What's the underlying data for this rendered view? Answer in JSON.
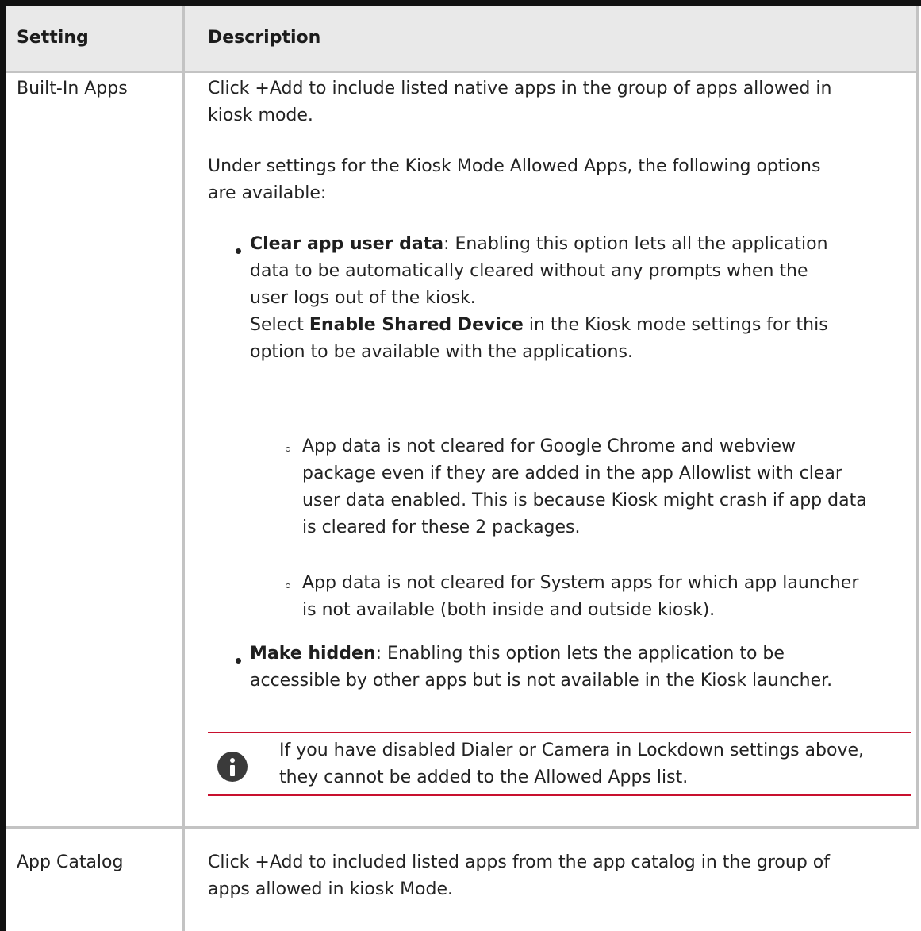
{
  "table": {
    "headers": {
      "setting": "Setting",
      "description": "Description"
    },
    "row1": {
      "setting": "Built-In Apps",
      "intro": [
        "Click +Add to include listed native apps in the group of apps allowed in",
        "kiosk mode."
      ],
      "under": [
        "Under settings for the Kiosk Mode Allowed Apps, the following options",
        "are available:"
      ],
      "clear_app": {
        "term": "Clear app user data",
        "line1_rest": ": Enabling this option lets all the application",
        "line2": "data to be automatically cleared without any prompts when the",
        "line3": "user logs out of the kiosk.",
        "line4_pre": "Select ",
        "line4_bold": "Enable Shared Device",
        "line4_post": " in the Kiosk mode settings for this",
        "line5": "option to be available with the applications."
      },
      "sub1": [
        "App data is not cleared for Google Chrome and webview",
        "package even if they are added in the app Allowlist with clear",
        "user data enabled. This is because Kiosk might crash if app data",
        "is cleared for these 2 packages."
      ],
      "sub2": [
        "App data is not cleared for System apps for which app launcher",
        "is not available (both inside and outside kiosk)."
      ],
      "make_hidden": {
        "term": "Make hidden",
        "line1_rest": ": Enabling this option lets the application to be",
        "line2": "accessible by other apps but is not available in the Kiosk launcher."
      },
      "note": [
        "If you have disabled Dialer or Camera in Lockdown settings above,",
        "they cannot be added to the Allowed Apps list."
      ],
      "note_icon": "info-icon"
    },
    "row2": {
      "setting": "App Catalog",
      "desc": [
        "Click +Add to included listed apps from the app catalog in the group of",
        "apps allowed in kiosk Mode."
      ]
    }
  },
  "colors": {
    "header_bg": "#e9e9e9",
    "border": "#c3c3c3",
    "frame": "#111111",
    "note_rule": "#c8102e"
  }
}
